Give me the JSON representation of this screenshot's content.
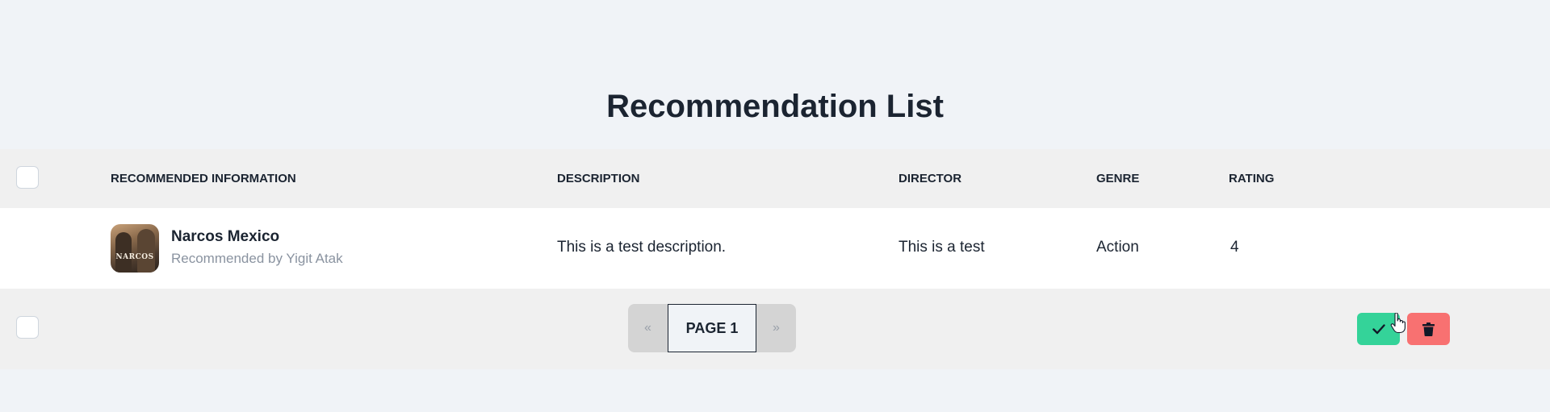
{
  "page": {
    "title": "Recommendation List"
  },
  "table": {
    "headers": {
      "info": "RECOMMENDED INFORMATION",
      "description": "DESCRIPTION",
      "director": "DIRECTOR",
      "genre": "GENRE",
      "rating": "RATING"
    },
    "rows": [
      {
        "title": "Narcos Mexico",
        "recommended_by": "Recommended by Yigit Atak",
        "poster_text": "NARCOS",
        "description": "This is a test description.",
        "director": "This is a test",
        "genre": "Action",
        "rating": "4"
      }
    ]
  },
  "pagination": {
    "prev": "«",
    "current": "PAGE 1",
    "next": "»"
  },
  "icons": {
    "approve": "check-icon",
    "delete": "trash-icon"
  },
  "colors": {
    "approve": "#34d399",
    "delete": "#f87171",
    "background": "#f0f3f7",
    "text": "#1b2431"
  }
}
